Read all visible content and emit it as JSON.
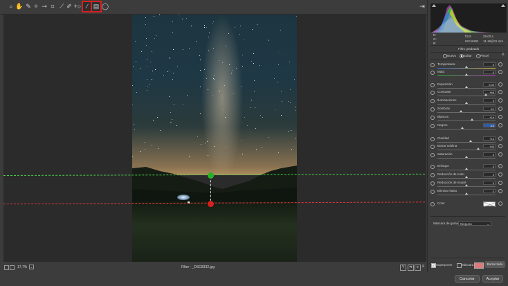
{
  "toolbar": {
    "tools": [
      {
        "name": "zoom-tool-icon",
        "glyph": "⌕"
      },
      {
        "name": "hand-tool-icon",
        "glyph": "✋"
      },
      {
        "name": "white-balance-tool-icon",
        "glyph": "✎"
      },
      {
        "name": "color-sampler-tool-icon",
        "glyph": "✧"
      },
      {
        "name": "targeted-adjustment-tool-icon",
        "glyph": "⊸"
      },
      {
        "name": "crop-tool-icon",
        "glyph": "⌗"
      },
      {
        "name": "straighten-tool-icon",
        "glyph": "⟋"
      },
      {
        "name": "spot-removal-tool-icon",
        "glyph": "✐"
      },
      {
        "name": "red-eye-tool-icon",
        "glyph": "+○"
      },
      {
        "name": "adjustment-brush-icon",
        "glyph": "⁄"
      },
      {
        "name": "graduated-filter-icon",
        "glyph": "▤"
      },
      {
        "name": "radial-filter-icon",
        "glyph": "◯"
      }
    ],
    "right_icon": "⇥"
  },
  "status": {
    "zoom": "17,7%",
    "filename": "Filter - _DSC8332.jpg"
  },
  "footer": {
    "cancel": "Cancelar",
    "accept": "Aceptar"
  },
  "histogram": {
    "r_label": "R:",
    "g_label": "G:",
    "b_label": "B:",
    "f": "f/2,8",
    "shutter": "25,00 s",
    "iso": "ISO 6400",
    "lens": "11-16@11 mm"
  },
  "panel": {
    "title": "Filtro graduado",
    "mode_new": "Nuevo",
    "mode_edit": "Editar",
    "mode_brush": "Pincel",
    "sliders": [
      {
        "label": "Temperatura",
        "value": "0",
        "pos": 0.5
      },
      {
        "label": "Matiz",
        "value": "0",
        "pos": 0.5
      },
      {
        "label": "Exposición",
        "value": "0,00",
        "pos": 0.5
      },
      {
        "label": "Contraste",
        "value": "+66",
        "pos": 0.83
      },
      {
        "label": "Iluminaciones",
        "value": "0",
        "pos": 0.5
      },
      {
        "label": "Sombras",
        "value": "-21",
        "pos": 0.4
      },
      {
        "label": "Blancos",
        "value": "+19",
        "pos": 0.6
      },
      {
        "label": "Negros",
        "value": "-14",
        "pos": 0.43,
        "selected": true
      },
      {
        "label": "Claridad",
        "value": "+13",
        "pos": 0.57
      },
      {
        "label": "Borrar neblina",
        "value": "+40",
        "pos": 0.7
      },
      {
        "label": "Saturación",
        "value": "0",
        "pos": 0.5
      },
      {
        "label": "Enfoque",
        "value": "0",
        "pos": 0.5
      },
      {
        "label": "Reducción de ruido",
        "value": "0",
        "pos": 0.5
      },
      {
        "label": "Reducción de muaré",
        "value": "0",
        "pos": 0.5
      },
      {
        "label": "Eliminar halos",
        "value": "0",
        "pos": 0.5
      }
    ],
    "color_label": "Color",
    "range_mask_label": "Máscara de gama:",
    "range_mask_value": "Ninguno",
    "overlay_label": "Superponer",
    "mask_label": "Máscara",
    "delete_all": "Borrar todo"
  },
  "colors": {
    "green_guide": "#4cd24c",
    "red_guide": "#e23b3b",
    "mask_swatch": "#e07a7a"
  }
}
